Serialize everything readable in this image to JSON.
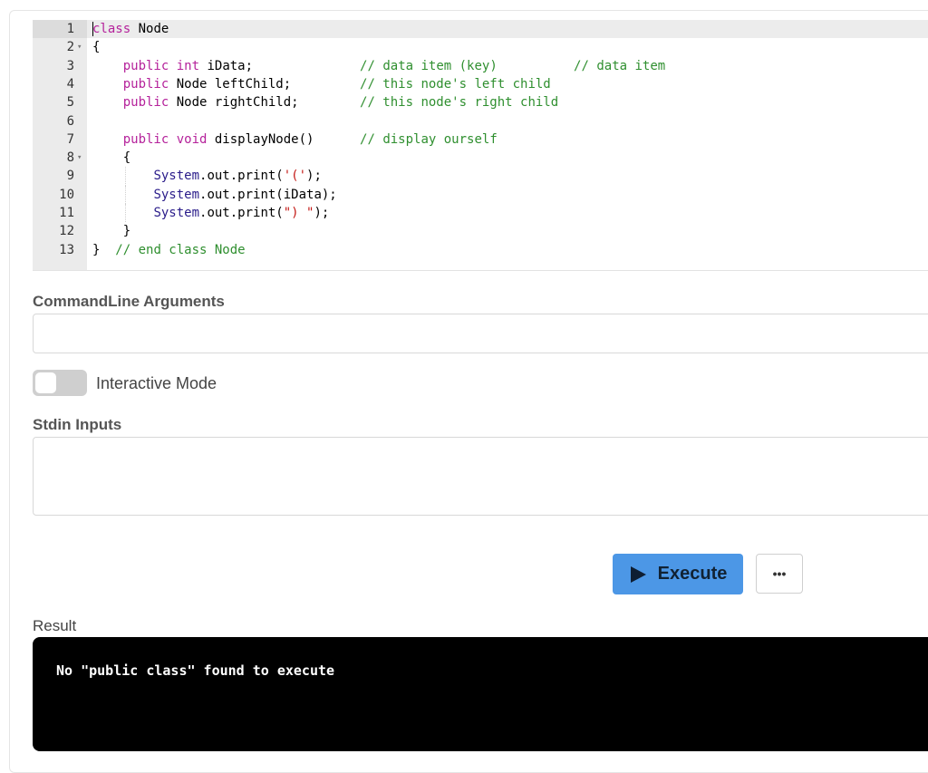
{
  "editor": {
    "lines": [
      {
        "n": "1",
        "fold": false
      },
      {
        "n": "2",
        "fold": true
      },
      {
        "n": "3",
        "fold": false
      },
      {
        "n": "4",
        "fold": false
      },
      {
        "n": "5",
        "fold": false
      },
      {
        "n": "6",
        "fold": false
      },
      {
        "n": "7",
        "fold": false
      },
      {
        "n": "8",
        "fold": true
      },
      {
        "n": "9",
        "fold": false
      },
      {
        "n": "10",
        "fold": false
      },
      {
        "n": "11",
        "fold": false
      },
      {
        "n": "12",
        "fold": false
      },
      {
        "n": "13",
        "fold": false
      }
    ],
    "fold_icon": "caret-down-icon",
    "code": [
      [
        {
          "t": "class",
          "c": "kw"
        },
        {
          "t": " Node"
        }
      ],
      [
        {
          "t": "{"
        }
      ],
      [
        {
          "t": "    "
        },
        {
          "t": "public",
          "c": "kw"
        },
        {
          "t": " "
        },
        {
          "t": "int",
          "c": "kw"
        },
        {
          "t": " iData;              "
        },
        {
          "t": "// data item (key)          // data item",
          "c": "cm"
        }
      ],
      [
        {
          "t": "    "
        },
        {
          "t": "public",
          "c": "kw"
        },
        {
          "t": " Node leftChild;         "
        },
        {
          "t": "// this node's left child",
          "c": "cm"
        }
      ],
      [
        {
          "t": "    "
        },
        {
          "t": "public",
          "c": "kw"
        },
        {
          "t": " Node rightChild;        "
        },
        {
          "t": "// this node's right child",
          "c": "cm"
        }
      ],
      [
        {
          "t": ""
        }
      ],
      [
        {
          "t": "    "
        },
        {
          "t": "public",
          "c": "kw"
        },
        {
          "t": " "
        },
        {
          "t": "void",
          "c": "kw"
        },
        {
          "t": " displayNode()      "
        },
        {
          "t": "// display ourself",
          "c": "cm"
        }
      ],
      [
        {
          "t": "    {"
        }
      ],
      [
        {
          "t": "        "
        },
        {
          "t": "System",
          "c": "ty"
        },
        {
          "t": ".out.print("
        },
        {
          "t": "'('",
          "c": "str"
        },
        {
          "t": ");"
        }
      ],
      [
        {
          "t": "        "
        },
        {
          "t": "System",
          "c": "ty"
        },
        {
          "t": ".out.print(iData);"
        }
      ],
      [
        {
          "t": "        "
        },
        {
          "t": "System",
          "c": "ty"
        },
        {
          "t": ".out.print("
        },
        {
          "t": "\") \"",
          "c": "str"
        },
        {
          "t": ");"
        }
      ],
      [
        {
          "t": "    }"
        }
      ],
      [
        {
          "t": "}  "
        },
        {
          "t": "// end class Node",
          "c": "cm"
        }
      ]
    ]
  },
  "args": {
    "label": "CommandLine Arguments",
    "value": ""
  },
  "interactive": {
    "label": "Interactive Mode",
    "on": false
  },
  "stdin": {
    "label": "Stdin Inputs",
    "value": ""
  },
  "execute": {
    "label": "Execute",
    "icon": "play-icon",
    "color": "#4c97e6"
  },
  "more": {
    "label": "•••",
    "icon": "more-icon"
  },
  "result": {
    "label": "Result",
    "output": "No \"public class\" found to execute"
  }
}
